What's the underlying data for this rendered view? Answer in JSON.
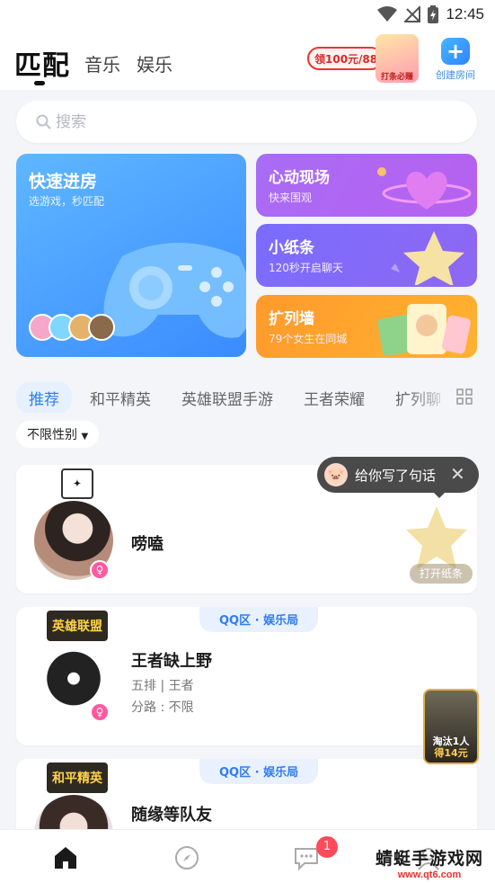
{
  "status_bar": {
    "time": "12:45"
  },
  "header": {
    "tabs": [
      "匹配",
      "音乐",
      "娱乐"
    ],
    "promo_text": "领100元/88",
    "promo_badge": "打条必赚",
    "create_room_label": "创建房间"
  },
  "search": {
    "placeholder": "搜索"
  },
  "cards": {
    "quick": {
      "title": "快速进房",
      "subtitle": "选游戏，秒匹配"
    },
    "heart": {
      "title": "心动现场",
      "subtitle": "快来围观"
    },
    "note": {
      "title": "小纸条",
      "subtitle": "120秒开启聊天"
    },
    "wall": {
      "title": "扩列墙",
      "subtitle": "79个女生在同城"
    }
  },
  "categories": [
    "推荐",
    "和平精英",
    "英雄联盟手游",
    "王者荣耀",
    "扩列聊"
  ],
  "filter": {
    "gender_label": "不限性别"
  },
  "tooltip": {
    "text": "给你写了句话"
  },
  "users": [
    {
      "name": "唠嗑",
      "action": "打开纸条"
    },
    {
      "region": "QQ区 · 娱乐局",
      "game_logo": "英雄联盟",
      "name": "王者缺上野",
      "info1": "五排 | 王者",
      "info2": "分路 : 不限"
    },
    {
      "region": "QQ区 · 娱乐局",
      "game_logo": "和平精英",
      "name": "随缘等队友"
    }
  ],
  "float_ad": {
    "line1": "淘汰1人",
    "line2": "得14元"
  },
  "bottom_nav": {
    "message_badge": "1"
  },
  "watermark": {
    "main": "蜻蜓手游戏网",
    "url": "www.qt6.com"
  }
}
